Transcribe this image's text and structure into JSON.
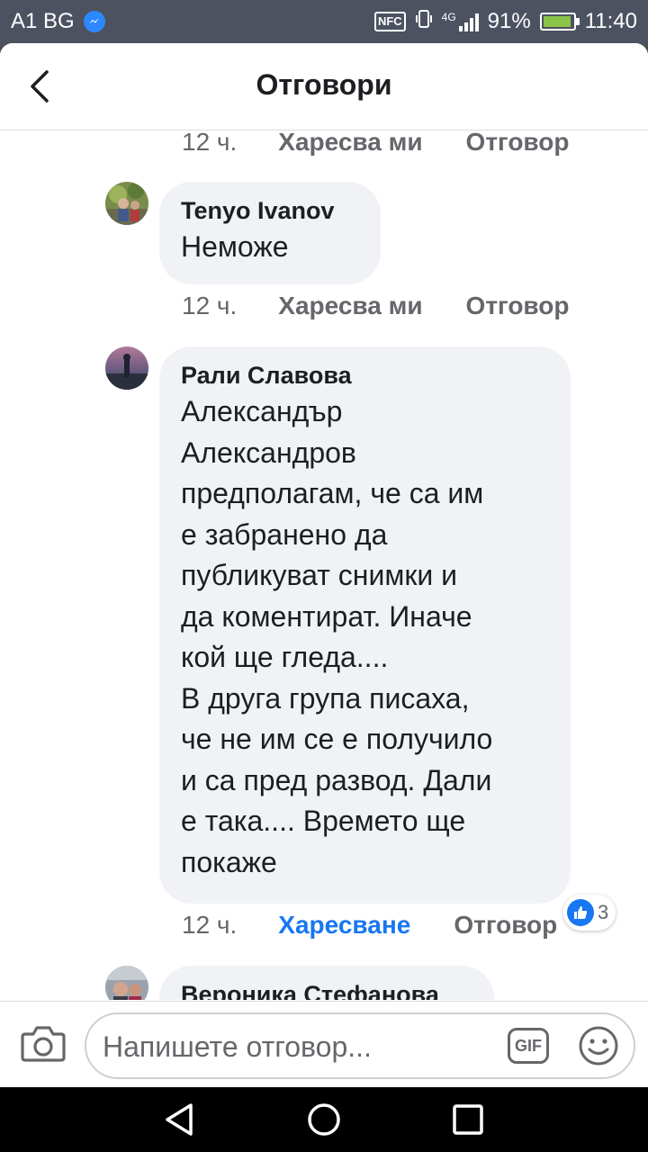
{
  "status_bar": {
    "carrier": "A1 BG",
    "nfc": "NFC",
    "network": "4G",
    "battery": "91%",
    "time": "11:40",
    "icons": [
      "messenger-icon",
      "nfc-icon",
      "vibrate-icon",
      "signal-icon",
      "battery-icon"
    ]
  },
  "header": {
    "title": "Отговори",
    "back_icon": "chevron-left-icon"
  },
  "comments": [
    {
      "actions": {
        "time": "12 ч.",
        "like": "Харесва ми",
        "reply": "Отговор"
      }
    },
    {
      "author": "Tenyo Ivanov",
      "text": "Неможе",
      "actions": {
        "time": "12 ч.",
        "like": "Харесва ми",
        "reply": "Отговор"
      }
    },
    {
      "author": "Рали Славова",
      "text": "Александър\nАлександров\nпредполагам, че са им\nе забранено да\nпубликуват снимки и\nда коментират. Иначе\nкой ще гледа....\nВ друга група писаха,\nче не им се е получило\nи са пред развод. Дали\nе така.... Времето ще\nпокаже",
      "reactions": {
        "count": "3",
        "icon": "like-icon"
      },
      "actions": {
        "time": "12 ч.",
        "like": "Харесване",
        "reply": "Отговор"
      }
    },
    {
      "author": "Вероника Стефанова"
    }
  ],
  "composer": {
    "placeholder": "Напишете отговор...",
    "gif_label": "GIF",
    "camera_icon": "camera-icon",
    "emoji_icon": "emoji-icon"
  },
  "colors": {
    "accent": "#1877f2",
    "bubble": "#f0f2f5",
    "meta_text": "#65676b",
    "text": "#1c1e21"
  }
}
